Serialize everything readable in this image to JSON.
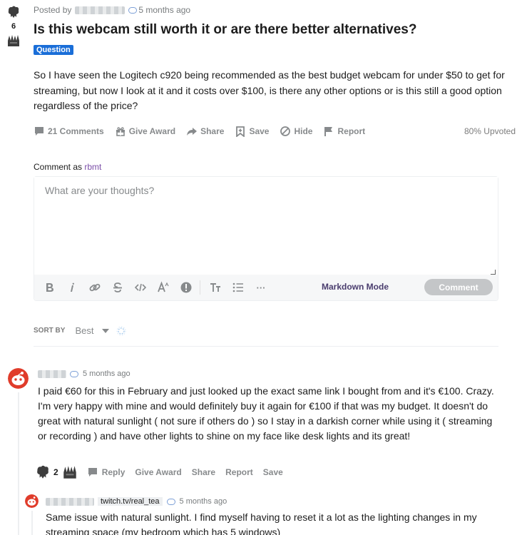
{
  "post": {
    "vote_count": "6",
    "posted_by": "Posted by",
    "time": "5 months ago",
    "title": "Is this webcam still worth it or are there better alternatives?",
    "flair": "Question",
    "body": "So I have seen the Logitech c920 being recommended as the best budget webcam for under $50 to get for streaming, but now I look at it and it costs over $100, is there any other options or is this still a good option regardless of the price?",
    "actions": {
      "comments": "21 Comments",
      "award": "Give Award",
      "share": "Share",
      "save": "Save",
      "hide": "Hide",
      "report": "Report"
    },
    "upvoted": "80% Upvoted"
  },
  "comment_box": {
    "comment_as_label": "Comment as",
    "username": "rbmt",
    "placeholder": "What are your thoughts?",
    "markdown_mode": "Markdown Mode",
    "submit": "Comment",
    "more": "···"
  },
  "sort": {
    "label": "SORT BY",
    "value": "Best"
  },
  "comments": [
    {
      "time": "5 months ago",
      "body": "I paid €60 for this in February and just looked up the exact same link I bought from and it's €100. Crazy. I'm very happy with mine and would definitely buy it again for €100 if that was my budget. It doesn't do great with natural sunlight ( not sure if others do ) so I stay in a darkish corner while using it ( streaming or recording ) and have other lights to shine on my face like desk lights and its great!",
      "votes": "2",
      "actions": {
        "reply": "Reply",
        "award": "Give Award",
        "share": "Share",
        "report": "Report",
        "save": "Save"
      }
    },
    {
      "user_flair": "twitch.tv/real_tea",
      "time": "5 months ago",
      "body": "Same issue with natural sunlight. I find myself having to reset it a lot as the lighting changes in my streaming space (my bedroom which has 5 windows)"
    }
  ],
  "colors": {
    "flair_bg": "#1a6ed8",
    "username": "#7b4ea8",
    "muted": "#878a8c",
    "comment_button_disabled": "#c4c6c8"
  }
}
